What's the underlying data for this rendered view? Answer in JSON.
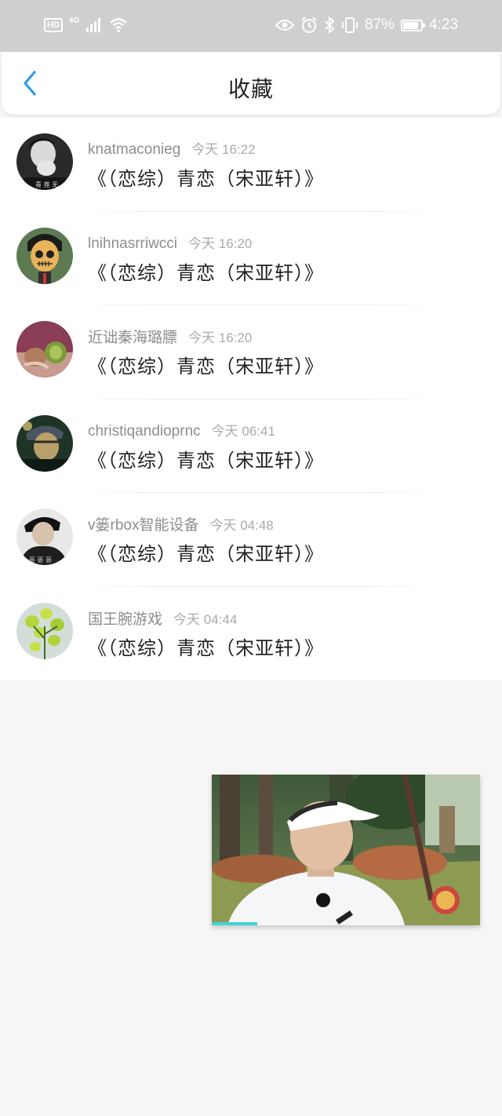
{
  "status_bar": {
    "hd": "HD",
    "network": "4G",
    "battery_percent": "87%",
    "battery_level": 0.87,
    "time": "4:23",
    "icons": [
      "signal-icon",
      "wifi-icon",
      "eye-icon",
      "alarm-icon",
      "bluetooth-icon",
      "vibrate-icon",
      "battery-icon"
    ]
  },
  "header": {
    "title": "收藏",
    "back_icon": "chevron-left-icon",
    "accent": "#2f9be8"
  },
  "favorites": [
    {
      "user": "knatmaconieg",
      "time": "今天 16:22",
      "title": "《（恋综）青恋（宋亚轩）》",
      "avatar": "person-photo"
    },
    {
      "user": "lnihnasrriwcci",
      "time": "今天 16:20",
      "title": "《（恋综）青恋（宋亚轩）》",
      "avatar": "skull-cartoon"
    },
    {
      "user": "近诎秦海璐膘",
      "time": "今天 16:20",
      "title": "《（恋综）青恋（宋亚轩）》",
      "avatar": "fruit-photo"
    },
    {
      "user": "christiqandioprnc",
      "time": "今天 06:41",
      "title": "《（恋综）青恋（宋亚轩）》",
      "avatar": "man-photo"
    },
    {
      "user": "v篓rbox智能设备",
      "time": "今天 04:48",
      "title": "《（恋综）青恋（宋亚轩）》",
      "avatar": "person-photo-2"
    },
    {
      "user": "国王腕游戏",
      "time": "今天 04:44",
      "title": "《（恋综）青恋（宋亚轩）》",
      "avatar": "flower-photo"
    }
  ],
  "video_pip": {
    "progress": 0.17
  }
}
